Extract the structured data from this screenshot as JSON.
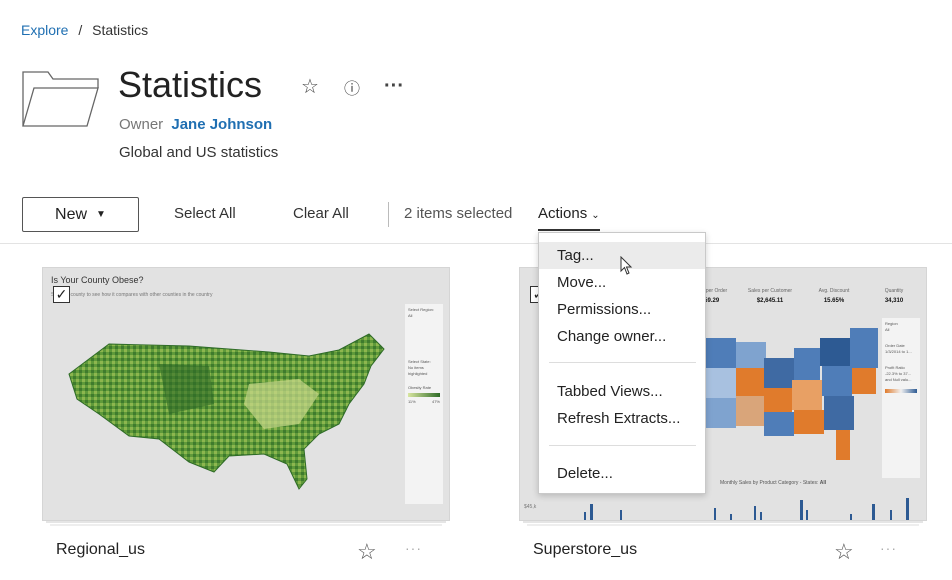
{
  "breadcrumb": {
    "explore": "Explore",
    "separator": "/",
    "current": "Statistics"
  },
  "project": {
    "title": "Statistics",
    "owner_label": "Owner",
    "owner_name": "Jane Johnson",
    "description": "Global and US statistics",
    "icons": [
      "star-outline-icon",
      "info-icon",
      "more-horizontal-icon"
    ]
  },
  "toolbar": {
    "new_label": "New",
    "select_all": "Select All",
    "clear_all": "Clear All",
    "selected_text": "2 items selected",
    "actions_label": "Actions"
  },
  "actions_menu": {
    "groups": [
      [
        "Tag...",
        "Move...",
        "Permissions...",
        "Change owner..."
      ],
      [
        "Tabbed Views...",
        "Refresh Extracts..."
      ],
      [
        "Delete..."
      ]
    ],
    "hovered": "Tag..."
  },
  "cards": [
    {
      "name": "Regional_us",
      "selected": true,
      "thumb_title": "Is Your County Obese?",
      "thumb_subtitle": "Select a county to see how it compares with other counties in the country",
      "thumb_side": [
        "Select Region:",
        "All",
        "Select State:",
        "No items highlighted",
        "Obesity Rate",
        "11%",
        "47%"
      ]
    },
    {
      "name": "Superstore_us",
      "selected": true,
      "thumb_stats": [
        {
          "label": "Profit per Order",
          "value": "$59.29"
        },
        {
          "label": "Sales per Customer",
          "value": "$2,645.11"
        },
        {
          "label": "Avg. Discount",
          "value": "15.65%"
        },
        {
          "label": "Quantity",
          "value": "34,310"
        }
      ],
      "thumb_side": [
        "Region",
        "All",
        "Order Date",
        "1/3/2014 to 1...",
        "Profit Ratio",
        "-22.3% to 37...",
        "and Null valu..."
      ],
      "thumb_bottom_title": "Monthly Sales by Product Category - States:",
      "thumb_bottom_value": "All",
      "thumb_left_label": "$45,k"
    }
  ],
  "colors": {
    "link": "#1f6fb2",
    "map_green_dark": "#2e6b27",
    "map_green_light": "#a9c76a",
    "map_blue": "#4f7db8",
    "map_orange": "#e07b2c"
  }
}
